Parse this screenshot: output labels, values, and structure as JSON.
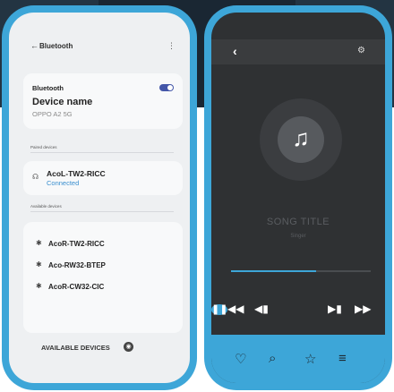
{
  "bluetooth": {
    "header": {
      "back_label": "Bluetooth",
      "back_icon": "←",
      "more_icon": "⋮"
    },
    "device": {
      "label": "Bluetooth",
      "name_label": "Device name",
      "name_value": "OPPO A2 5G",
      "enabled": true
    },
    "paired": {
      "section_title": "Paired devices",
      "items": [
        {
          "name": "AcoL-TW2-RICC",
          "status": "Connected"
        }
      ]
    },
    "available": {
      "section_title": "Available devices",
      "items": [
        {
          "name": "AcoR-TW2-RICC"
        },
        {
          "name": "Aco-RW32-BTEP"
        },
        {
          "name": "AcoR-CW32-CIC"
        }
      ]
    },
    "scan_label": "AVAILABLE DEVICES",
    "icons": {
      "bluetooth": "✱",
      "headset": "☊",
      "scan": "◉"
    }
  },
  "player": {
    "topbar": {
      "back_icon": "‹",
      "settings_icon": "⚙"
    },
    "song_title": "SONG TITLE",
    "artist": "Singer",
    "progress": 0.61,
    "icons": {
      "note": "♫",
      "rewind": "◀◀",
      "prev": "◀▮",
      "play_pause": "❚❚",
      "next": "▶▮",
      "ff": "▶▶",
      "heart": "♡",
      "search": "⌕",
      "star": "☆",
      "menu": "≡"
    },
    "colors": {
      "accent": "#3da6d8",
      "screen": "#2f3133"
    }
  }
}
